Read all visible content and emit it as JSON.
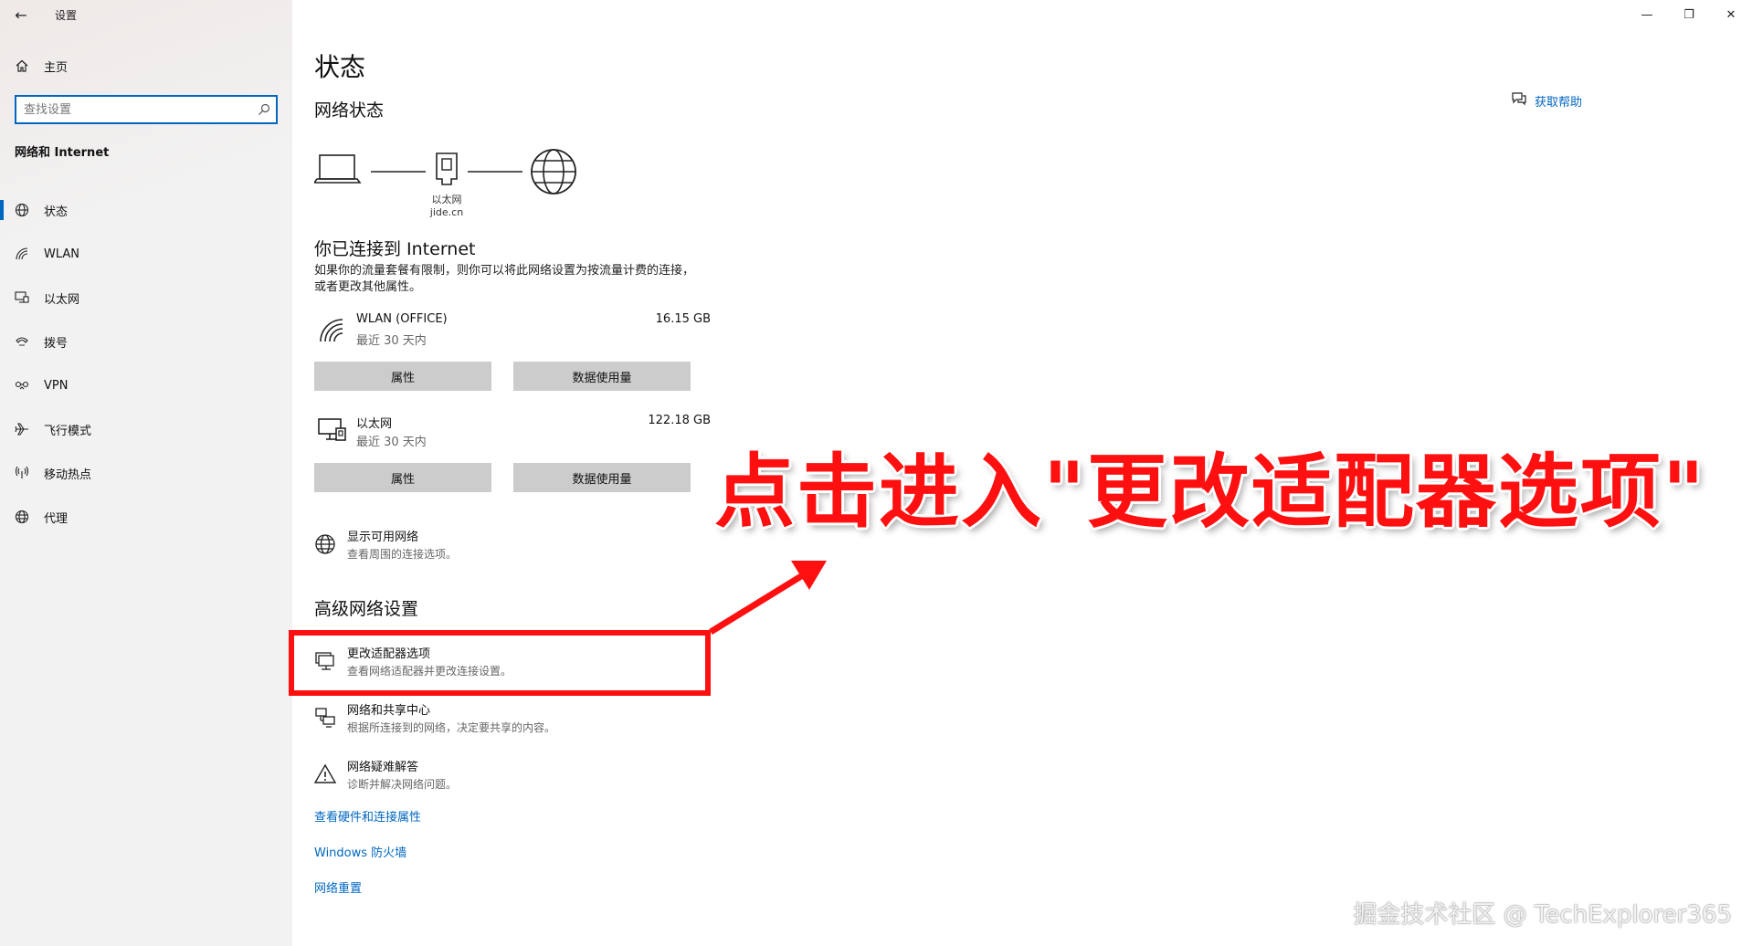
{
  "window": {
    "title": "设置",
    "back_glyph": "←",
    "minimize_glyph": "—",
    "restore_glyph": "❐",
    "close_glyph": "✕"
  },
  "sidebar": {
    "home_label": "主页",
    "search_placeholder": "查找设置",
    "section_title": "网络和 Internet",
    "items": [
      {
        "label": "状态",
        "icon": "globe-icon",
        "active": true
      },
      {
        "label": "WLAN",
        "icon": "wifi-icon",
        "active": false
      },
      {
        "label": "以太网",
        "icon": "ethernet-icon",
        "active": false
      },
      {
        "label": "拨号",
        "icon": "dialup-icon",
        "active": false
      },
      {
        "label": "VPN",
        "icon": "vpn-icon",
        "active": false
      },
      {
        "label": "飞行模式",
        "icon": "airplane-icon",
        "active": false
      },
      {
        "label": "移动热点",
        "icon": "hotspot-icon",
        "active": false
      },
      {
        "label": "代理",
        "icon": "proxy-globe-icon",
        "active": false
      }
    ]
  },
  "main": {
    "title": "状态",
    "network_status_title": "网络状态",
    "help_label": "获取帮助",
    "diagram": {
      "adapter_label": "以太网",
      "network_label": "jide.cn"
    },
    "connected_title": "你已连接到 Internet",
    "connected_desc": "如果你的流量套餐有限制，则你可以将此网络设置为按流量计费的连接，或者更改其他属性。",
    "connections": [
      {
        "name": "WLAN (OFFICE)",
        "sub": "最近 30 天内",
        "size": "16.15 GB",
        "icon": "wifi-icon",
        "properties_label": "属性",
        "data_usage_label": "数据使用量"
      },
      {
        "name": "以太网",
        "sub": "最近 30 天内",
        "size": "122.18 GB",
        "icon": "ethernet-icon",
        "properties_label": "属性",
        "data_usage_label": "数据使用量"
      }
    ],
    "show_networks": {
      "title": "显示可用网络",
      "desc": "查看周围的连接选项。"
    },
    "advanced_title": "高级网络设置",
    "advanced_items": [
      {
        "title": "更改适配器选项",
        "desc": "查看网络适配器并更改连接设置。",
        "icon": "adapter-icon"
      },
      {
        "title": "网络和共享中心",
        "desc": "根据所连接到的网络，决定要共享的内容。",
        "icon": "sharing-center-icon"
      },
      {
        "title": "网络疑难解答",
        "desc": "诊断并解决网络问题。",
        "icon": "warning-icon"
      }
    ],
    "links": [
      "查看硬件和连接属性",
      "Windows 防火墙",
      "网络重置"
    ]
  },
  "annotation": {
    "text": "点击进入\"更改适配器选项\"",
    "color": "#ff1010"
  },
  "watermark": "掘金技术社区 @ TechExplorer365",
  "colors": {
    "accent": "#0067c0",
    "button": "#cccccc",
    "annotation": "#ff1010"
  }
}
